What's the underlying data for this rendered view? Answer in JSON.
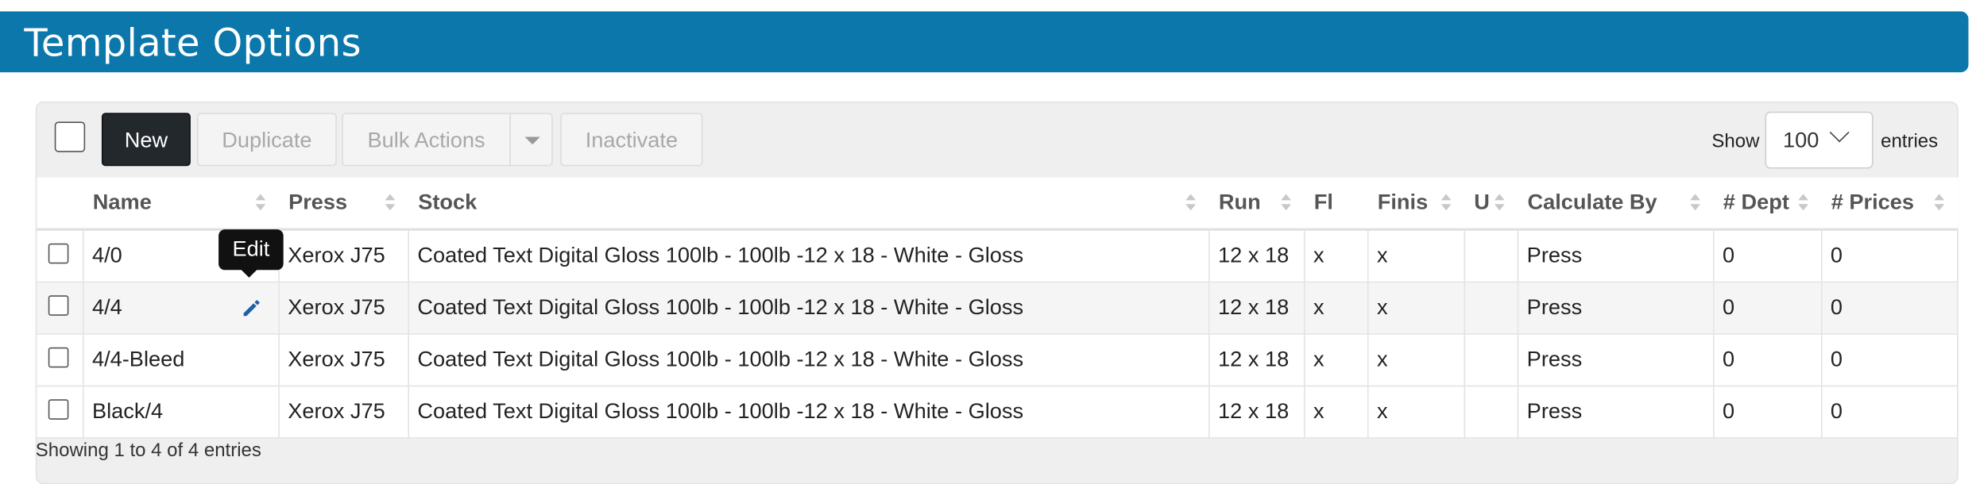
{
  "header": {
    "title": "Template Options"
  },
  "toolbar": {
    "new_label": "New",
    "duplicate_label": "Duplicate",
    "bulk_actions_label": "Bulk Actions",
    "inactivate_label": "Inactivate",
    "show_label": "Show",
    "entries_value": "100",
    "entries_label": "entries"
  },
  "table": {
    "columns": [
      "Name",
      "Press",
      "Stock",
      "Run",
      "Fl",
      "Finis",
      "U",
      "Calculate By",
      "# Dept",
      "# Prices"
    ],
    "rows": [
      {
        "name": "4/0",
        "press": "Xerox J75",
        "stock": "Coated Text Digital Gloss 100lb - 100lb -12 x 18 - White - Gloss",
        "run": "12 x 18",
        "fl": "x",
        "finis": "x",
        "u": "",
        "calc": "Press",
        "dept": "0",
        "prices": "0"
      },
      {
        "name": "4/4",
        "press": "Xerox J75",
        "stock": "Coated Text Digital Gloss 100lb - 100lb -12 x 18 - White - Gloss",
        "run": "12 x 18",
        "fl": "x",
        "finis": "x",
        "u": "",
        "calc": "Press",
        "dept": "0",
        "prices": "0"
      },
      {
        "name": "4/4-Bleed",
        "press": "Xerox J75",
        "stock": "Coated Text Digital Gloss 100lb - 100lb -12 x 18 - White - Gloss",
        "run": "12 x 18",
        "fl": "x",
        "finis": "x",
        "u": "",
        "calc": "Press",
        "dept": "0",
        "prices": "0"
      },
      {
        "name": "Black/4",
        "press": "Xerox J75",
        "stock": "Coated Text Digital Gloss 100lb - 100lb -12 x 18 - White - Gloss",
        "run": "12 x 18",
        "fl": "x",
        "finis": "x",
        "u": "",
        "calc": "Press",
        "dept": "0",
        "prices": "0"
      }
    ]
  },
  "tooltip": {
    "text": "Edit"
  },
  "footer": {
    "text": "Showing 1 to 4 of 4 entries"
  },
  "colors": {
    "header_bg": "#0b77aa",
    "new_button_bg": "#23282d",
    "edit_icon": "#1f5fa8"
  },
  "icons": {
    "edit": "pencil-icon",
    "sort": "sort-arrows-icon",
    "dropdown": "chevron-down-icon"
  }
}
